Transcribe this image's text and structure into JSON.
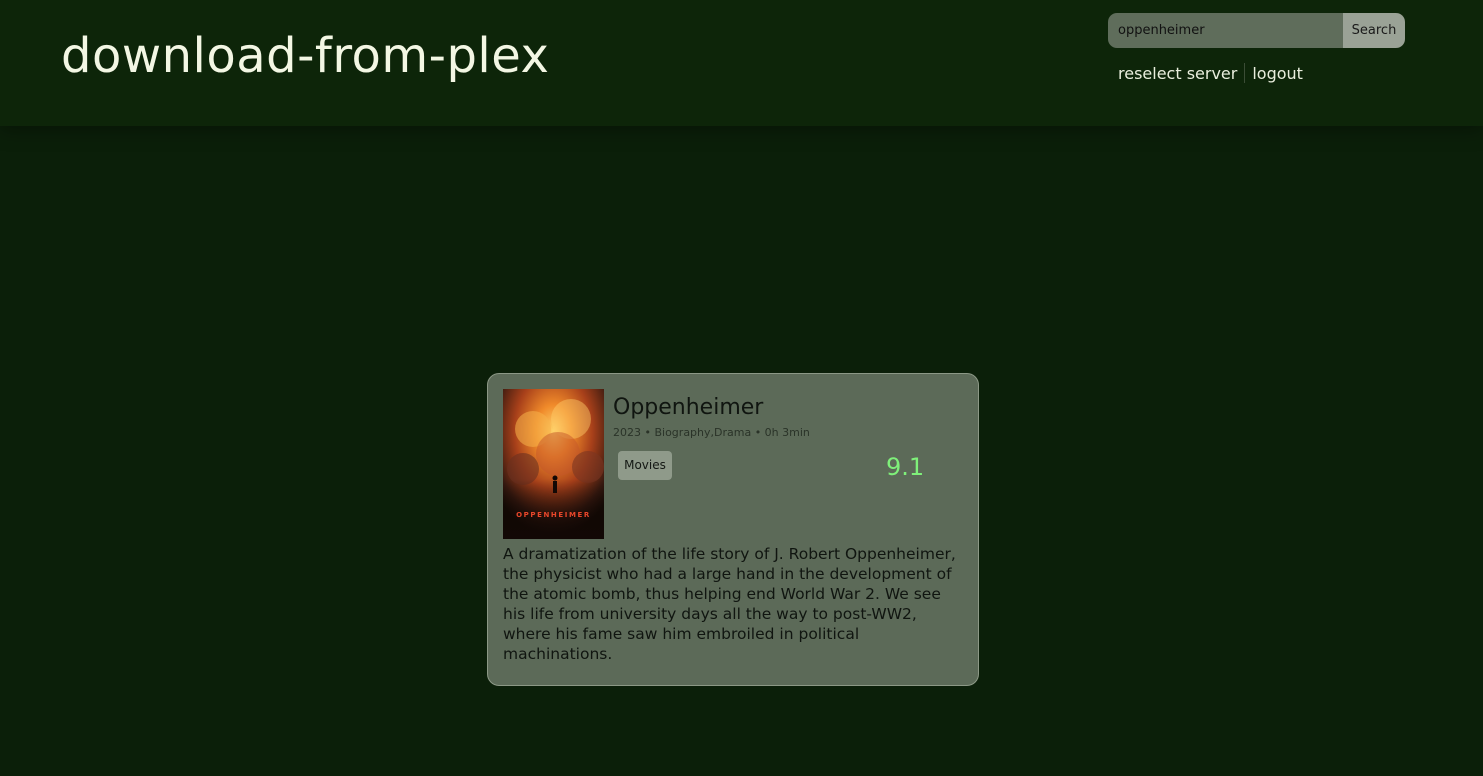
{
  "header": {
    "site_title": "download-from-plex",
    "search": {
      "value": "oppenheimer",
      "button_label": "Search"
    },
    "nav": {
      "reselect_label": "reselect server",
      "logout_label": "logout"
    }
  },
  "result": {
    "title": "Oppenheimer",
    "meta": "2023 • Biography,Drama • 0h 3min",
    "library_badge": "Movies",
    "rating": "9.1",
    "summary": "A dramatization of the life story of J. Robert Oppenheimer, the physicist who had a large hand in the development of the atomic bomb, thus helping end World War 2. We see his life from university days all the way to post-WW2, where his fame saw him embroiled in political machinations.",
    "poster_caption": "OPPENHEIMER"
  },
  "colors": {
    "background": "#0b1f09",
    "header": "#0d2509",
    "card": "#5c6a58",
    "rating": "#7ff07a",
    "poster_text": "#e8462a"
  }
}
